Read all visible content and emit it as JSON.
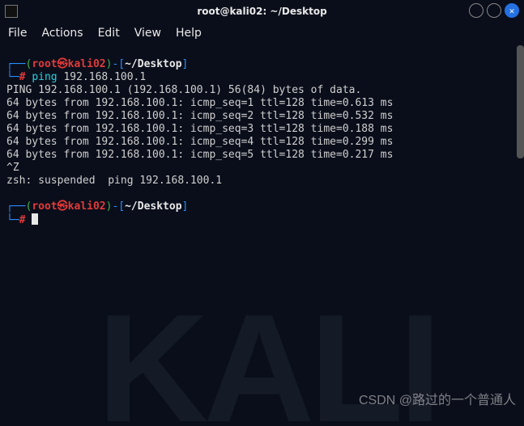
{
  "window": {
    "title": "root@kali02: ~/Desktop"
  },
  "menu": {
    "file": "File",
    "actions": "Actions",
    "edit": "Edit",
    "view": "View",
    "help": "Help"
  },
  "prompt": {
    "lparen": "(",
    "user": "root",
    "at": "㉿",
    "host": "kali02",
    "rparen": ")",
    "dash_lbr": "-[",
    "cwd": "~/Desktop",
    "rbr": "]",
    "hash": "#"
  },
  "corner": {
    "topL": "┌──",
    "botL": "└─"
  },
  "cmd": {
    "name": "ping",
    "arg": " 192.168.100.1"
  },
  "out": {
    "header": "PING 192.168.100.1 (192.168.100.1) 56(84) bytes of data.",
    "l1": "64 bytes from 192.168.100.1: icmp_seq=1 ttl=128 time=0.613 ms",
    "l2": "64 bytes from 192.168.100.1: icmp_seq=2 ttl=128 time=0.532 ms",
    "l3": "64 bytes from 192.168.100.1: icmp_seq=3 ttl=128 time=0.188 ms",
    "l4": "64 bytes from 192.168.100.1: icmp_seq=4 ttl=128 time=0.299 ms",
    "l5": "64 bytes from 192.168.100.1: icmp_seq=5 ttl=128 time=0.217 ms",
    "ctrlz": "^Z",
    "suspend": "zsh: suspended  ping 192.168.100.1"
  },
  "watermark": "CSDN @路过的一个普通人",
  "bg": "KALI"
}
